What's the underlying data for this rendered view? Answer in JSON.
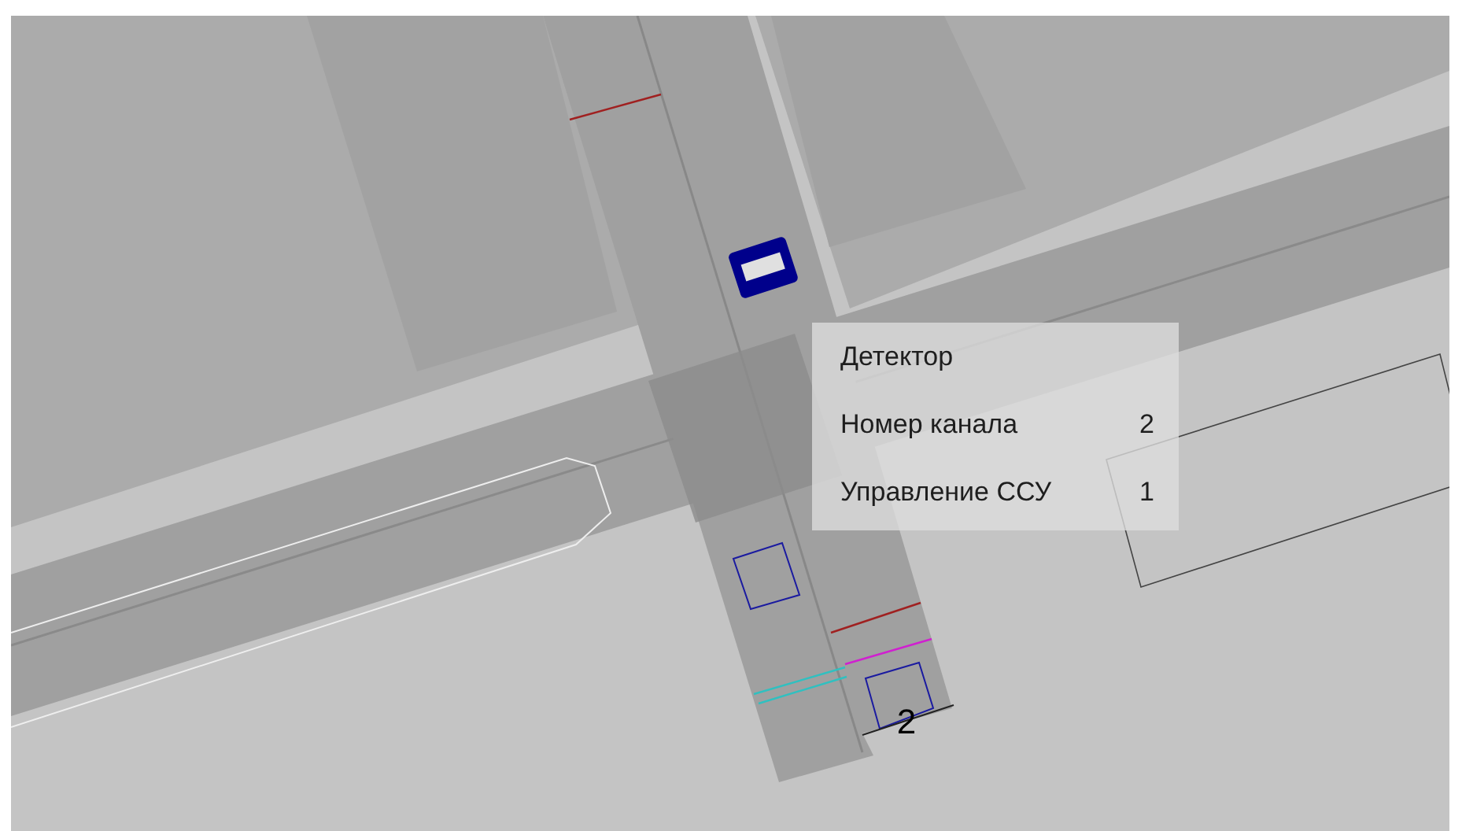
{
  "tooltip": {
    "title": "Детектор",
    "rows": [
      {
        "label": "Номер канала",
        "value": "2"
      },
      {
        "label": "Управление ССУ",
        "value": "1"
      }
    ]
  },
  "map": {
    "detector_label": "2"
  }
}
